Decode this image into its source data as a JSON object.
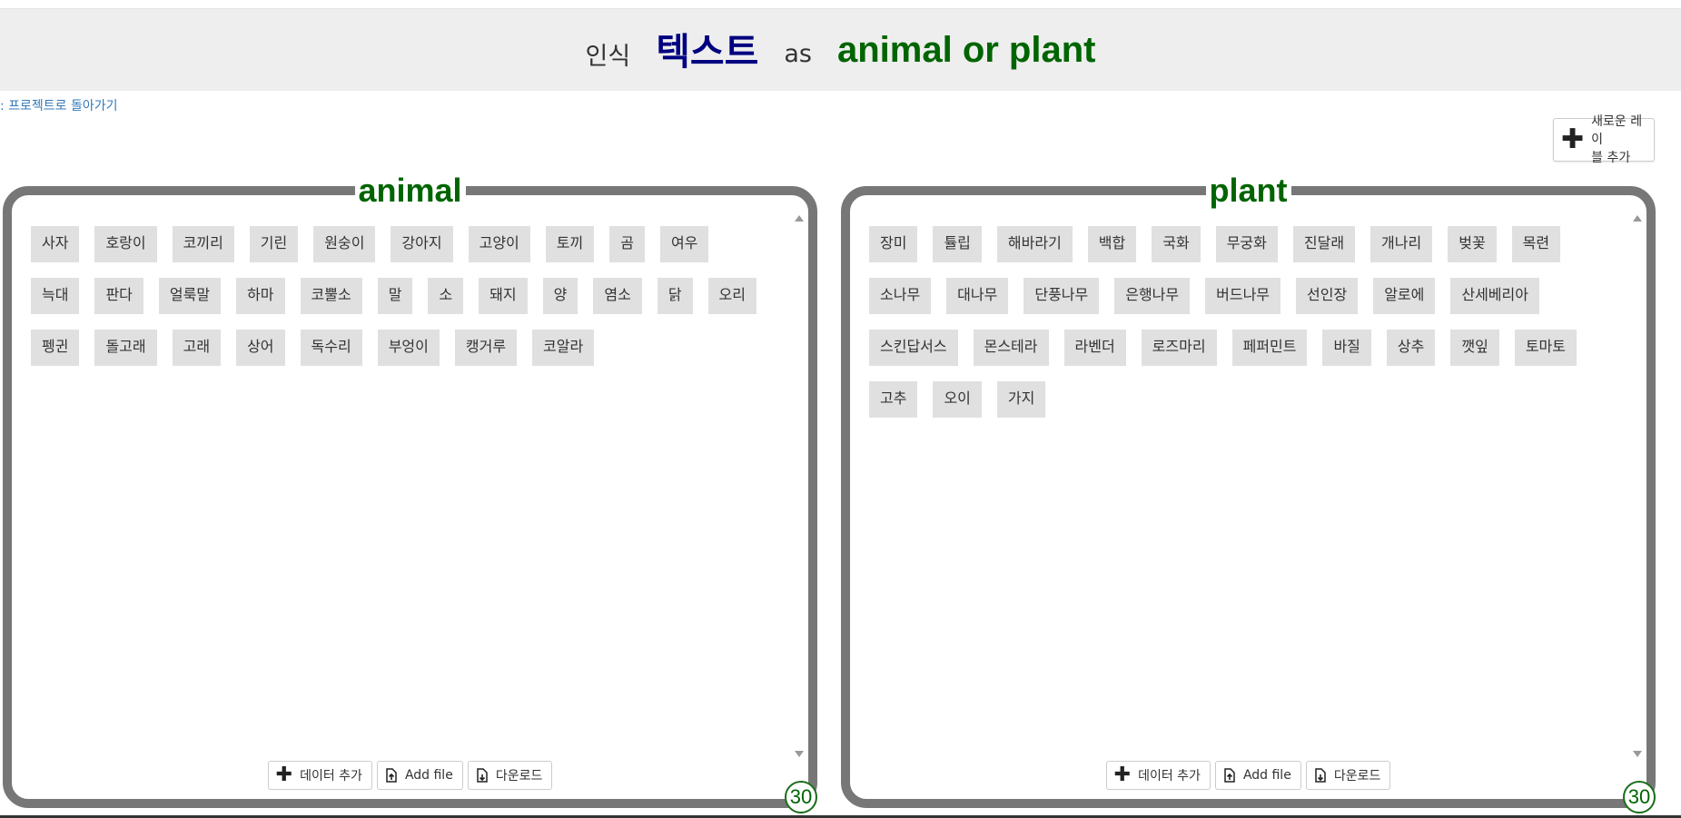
{
  "header": {
    "recognise": "인식",
    "type": "텍스트",
    "as": "as",
    "project": "animal or plant"
  },
  "back_link": ": 프로젝트로 돌아가기",
  "new_label_button": {
    "line1": "새로운 레이",
    "line2": "블 추가"
  },
  "colors": {
    "project_green": "#006400",
    "type_navy": "#000080",
    "bucket_border": "#777777",
    "item_bg": "#e0e0e0"
  },
  "buckets": [
    {
      "title": "animal",
      "items": [
        "사자",
        "호랑이",
        "코끼리",
        "기린",
        "원숭이",
        "강아지",
        "고양이",
        "토끼",
        "곰",
        "여우",
        "늑대",
        "판다",
        "얼룩말",
        "하마",
        "코뿔소",
        "말",
        "소",
        "돼지",
        "양",
        "염소",
        "닭",
        "오리",
        "펭귄",
        "돌고래",
        "고래",
        "상어",
        "독수리",
        "부엉이",
        "캥거루",
        "코알라"
      ],
      "buttons": {
        "add_data": "데이터 추가",
        "add_file": "Add file",
        "download": "다운로드"
      },
      "count": "30"
    },
    {
      "title": "plant",
      "items": [
        "장미",
        "튤립",
        "해바라기",
        "백합",
        "국화",
        "무궁화",
        "진달래",
        "개나리",
        "벚꽃",
        "목련",
        "소나무",
        "대나무",
        "단풍나무",
        "은행나무",
        "버드나무",
        "선인장",
        "알로에",
        "산세베리아",
        "스킨답서스",
        "몬스테라",
        "라벤더",
        "로즈마리",
        "페퍼민트",
        "바질",
        "상추",
        "깻잎",
        "토마토",
        "고추",
        "오이",
        "가지"
      ],
      "buttons": {
        "add_data": "데이터 추가",
        "add_file": "Add file",
        "download": "다운로드"
      },
      "count": "30"
    }
  ]
}
